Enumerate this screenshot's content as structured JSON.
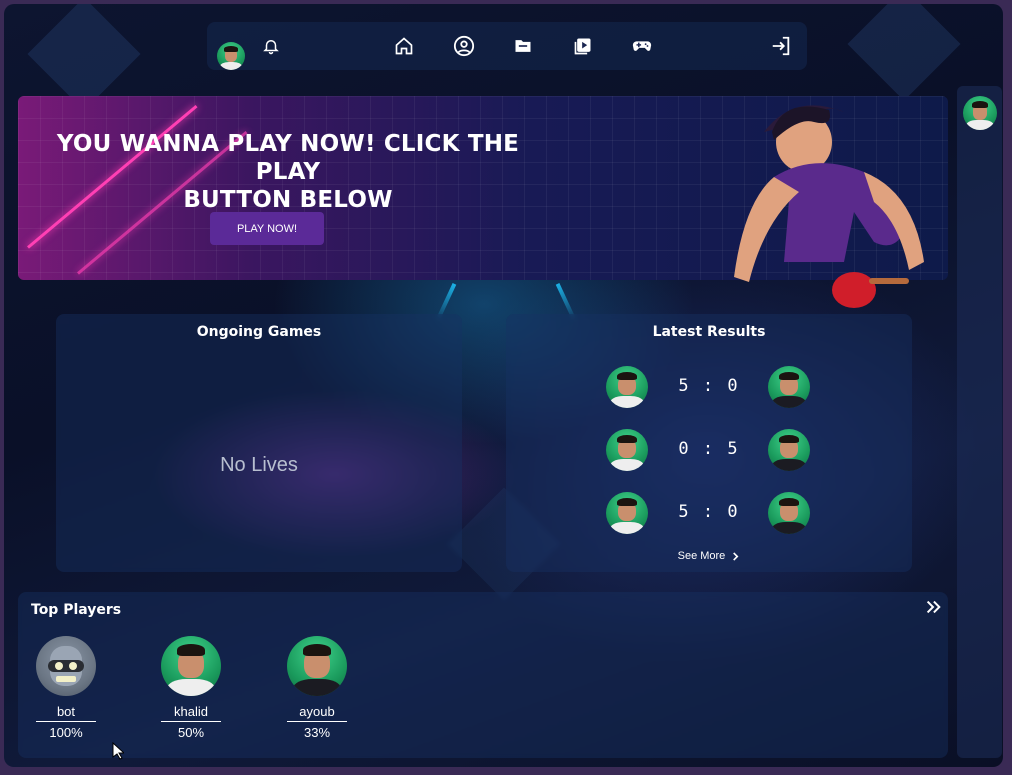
{
  "nav": {
    "icons": [
      "bell-icon",
      "home-icon",
      "user-circle-icon",
      "folder-icon",
      "video-play-icon",
      "gamepad-icon",
      "logout-icon"
    ]
  },
  "hero": {
    "title_line1": "YOU WANNA PLAY NOW! CLICK THE PLAY",
    "title_line2": "BUTTON BELOW",
    "play_label": "PLAY NOW!"
  },
  "ongoing": {
    "title": "Ongoing Games",
    "empty_text": "No Lives"
  },
  "latest": {
    "title": "Latest Results",
    "results": [
      {
        "score": "5 : 0"
      },
      {
        "score": "0 : 5"
      },
      {
        "score": "5 : 0"
      }
    ],
    "see_more": "See More"
  },
  "top_players": {
    "title": "Top Players",
    "players": [
      {
        "name": "bot",
        "rate": "100%"
      },
      {
        "name": "khalid",
        "rate": "50%"
      },
      {
        "name": "ayoub",
        "rate": "33%"
      }
    ]
  },
  "colors": {
    "accent": "#5b2a98",
    "neon_pink": "#ff3fb4",
    "neon_cyan": "#1ec8ff",
    "avatar_green": "#1a9a5c"
  }
}
